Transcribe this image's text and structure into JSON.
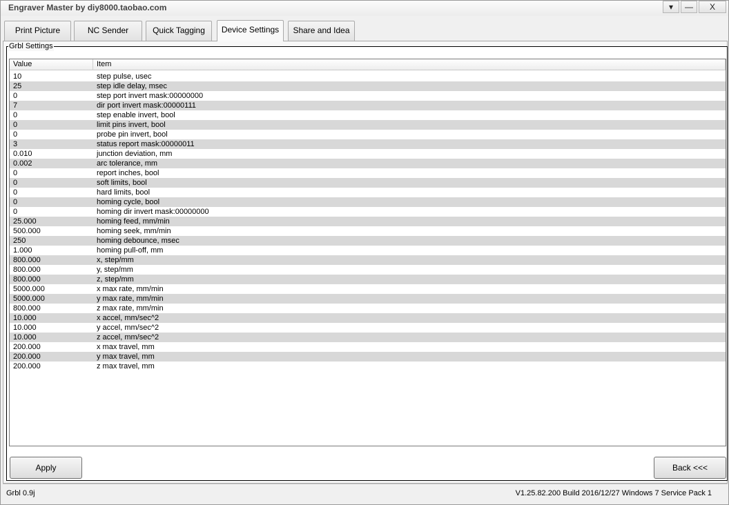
{
  "window": {
    "title": "Engraver Master by diy8000.taobao.com",
    "help_glyph": "▾",
    "min_glyph": "—",
    "close_glyph": "X"
  },
  "tabs": [
    {
      "label": "Print Picture",
      "active": false
    },
    {
      "label": "NC Sender",
      "active": false
    },
    {
      "label": "Quick Tagging",
      "active": false
    },
    {
      "label": "Device Settings",
      "active": true
    },
    {
      "label": "Share and Idea",
      "active": false
    }
  ],
  "group": {
    "label": "Grbl Settings"
  },
  "list": {
    "columns": [
      "Value",
      "Item"
    ],
    "rows": [
      {
        "value": "10",
        "item": "step pulse, usec"
      },
      {
        "value": "25",
        "item": "step idle delay, msec"
      },
      {
        "value": "0",
        "item": "step port invert mask:00000000"
      },
      {
        "value": "7",
        "item": "dir port invert mask:00000111"
      },
      {
        "value": "0",
        "item": "step enable invert, bool"
      },
      {
        "value": "0",
        "item": "limit pins invert, bool"
      },
      {
        "value": "0",
        "item": "probe pin invert, bool"
      },
      {
        "value": "3",
        "item": "status report mask:00000011"
      },
      {
        "value": "0.010",
        "item": "junction deviation, mm"
      },
      {
        "value": "0.002",
        "item": "arc tolerance, mm"
      },
      {
        "value": "0",
        "item": "report inches, bool"
      },
      {
        "value": "0",
        "item": "soft limits, bool"
      },
      {
        "value": "0",
        "item": "hard limits, bool"
      },
      {
        "value": "0",
        "item": "homing cycle, bool"
      },
      {
        "value": "0",
        "item": "homing dir invert mask:00000000"
      },
      {
        "value": "25.000",
        "item": "homing feed, mm/min"
      },
      {
        "value": "500.000",
        "item": "homing seek, mm/min"
      },
      {
        "value": "250",
        "item": "homing debounce, msec"
      },
      {
        "value": "1.000",
        "item": "homing pull-off, mm"
      },
      {
        "value": "800.000",
        "item": "x, step/mm"
      },
      {
        "value": "800.000",
        "item": "y, step/mm"
      },
      {
        "value": "800.000",
        "item": "z, step/mm"
      },
      {
        "value": "5000.000",
        "item": "x max rate, mm/min"
      },
      {
        "value": "5000.000",
        "item": "y max rate, mm/min"
      },
      {
        "value": "800.000",
        "item": "z max rate, mm/min"
      },
      {
        "value": "10.000",
        "item": "x accel, mm/sec^2"
      },
      {
        "value": "10.000",
        "item": "y accel, mm/sec^2"
      },
      {
        "value": "10.000",
        "item": "z accel, mm/sec^2"
      },
      {
        "value": "200.000",
        "item": "x max travel, mm"
      },
      {
        "value": "200.000",
        "item": "y max travel, mm"
      },
      {
        "value": "200.000",
        "item": "z max travel, mm"
      }
    ]
  },
  "buttons": {
    "apply": "Apply",
    "back": "Back <<<"
  },
  "status": {
    "left": "Grbl 0.9j",
    "right": "V1.25.82.200 Build 2016/12/27 Windows 7 Service Pack 1"
  }
}
